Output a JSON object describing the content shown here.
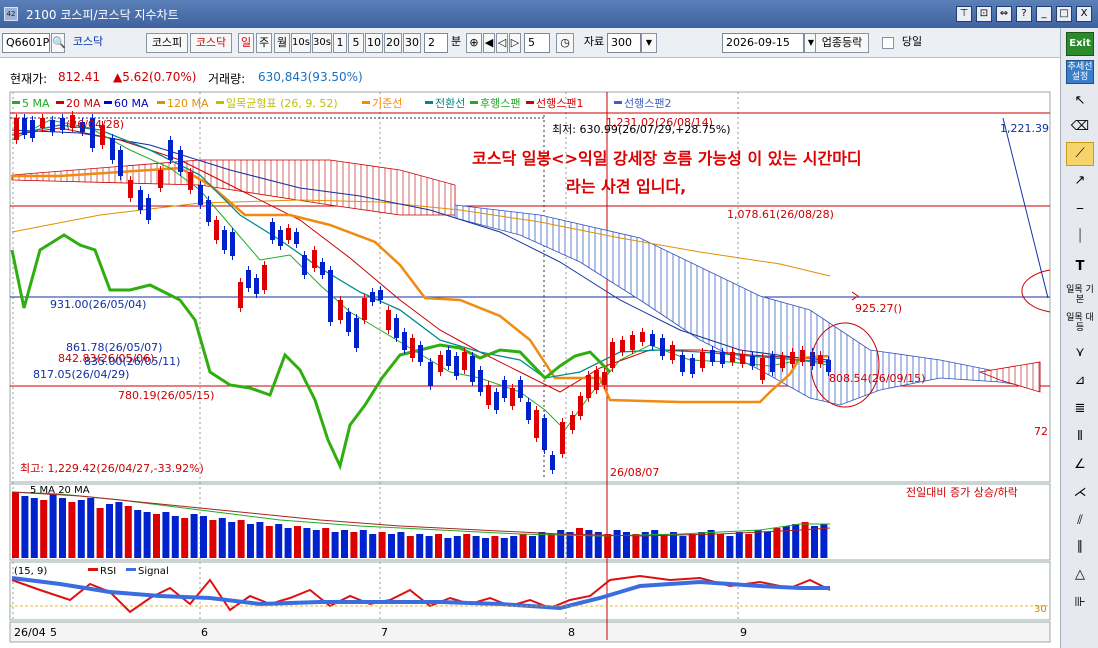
{
  "window": {
    "app_id": "2100",
    "title": "2100 코스피/코스닥 지수차트",
    "controls": [
      "⊤",
      "⊡",
      "⇔",
      "?",
      "_",
      "□",
      "X"
    ]
  },
  "toolbar": {
    "code": "Q6601P",
    "name": "코스닥",
    "market_kospi": "코스피",
    "market_kosdaq": "코스닥",
    "period_daily": "일",
    "period_weekly": "주",
    "period_monthly": "월",
    "period_10s": "10s",
    "period_30s": "30s",
    "min1": "1",
    "min5": "5",
    "min10": "10",
    "min20": "20",
    "min30": "30",
    "n_min_value": "2",
    "n_min_unit": "분",
    "step_value": "5",
    "data_label": "자료",
    "data_count": "300",
    "date": "2026-09-15",
    "sector_button": "업종등락",
    "today_checkbox": "당일"
  },
  "sidebar_tools": {
    "exit": "Exit",
    "trendline_setting": "추세선 설정",
    "ichimoku_base": "일목 기본",
    "ichimoku_equiv": "일목 대등"
  },
  "info": {
    "price_label": "현재가:",
    "price": "812.41",
    "change": "▲5.62(0.70%)",
    "volume_label": "거래량:",
    "volume": "630,843(93.50%)"
  },
  "legend": [
    {
      "label": "5 MA",
      "color": "#22aa22"
    },
    {
      "label": "20 MA",
      "color": "#cc0000"
    },
    {
      "label": "60 MA",
      "color": "#0000cc"
    },
    {
      "label": "120 MA",
      "color": "#e09000"
    },
    {
      "label": "일목균형표 (26, 9, 52)",
      "color": "#c0c000"
    },
    {
      "label": "기준선",
      "color": "#ff8800"
    },
    {
      "label": "전환선",
      "color": "#008888"
    },
    {
      "label": "후행스팬",
      "color": "#22aa22"
    },
    {
      "label": "선행스팬1",
      "color": "#cc0000"
    },
    {
      "label": "선행스팬2",
      "color": "#4060c0"
    }
  ],
  "annotations": {
    "headline_1": "코스닥 일봉<>익일 강세장 흐름 가능성 이 있는 시간마디",
    "headline_2": "라는 사견 입니다,",
    "high_near": "1,231.02(26/08/14)",
    "low_label": "최저: 630.99(26/07/29,+28.75%)",
    "level_1078": "1,078.61(26/08/28)",
    "level_931": "931.00(26/05/04)",
    "level_861": "861.78(26/05/07)",
    "level_842": "842.83(26/05/06)",
    "level_835": "835.00(26/05/11)",
    "level_817": "817.05(26/04/29)",
    "level_780": "780.19(26/05/15)",
    "level_925": "925.27()",
    "level_808": "808.54(26/09/15)",
    "level_1221": "1,221.39",
    "right_72": "72",
    "top_left_label": "(26/04/28)",
    "max_label": "최고: 1,229.42(26/04/27,-33.92%)",
    "date_marker": "26/08/07",
    "volume_title": "전일대비 증가 상승/하락",
    "volume_legend": "5 MA  20 MA",
    "rsi_legend_prefix": "(15, 9)",
    "rsi_legend_rsi": "RSI",
    "rsi_legend_signal": "Signal",
    "rsi_level": "30"
  },
  "x_axis": [
    "26/04",
    "5",
    "6",
    "7",
    "8",
    "9"
  ],
  "colors": {
    "up": "#dd0000",
    "down": "#0022cc",
    "ma5": "#22aa22",
    "ma20": "#cc0000",
    "ma60": "#1030a0",
    "ma120": "#e09000",
    "kijun": "#f08a10",
    "tenkan": "#008c8c",
    "chikou": "#2fae10",
    "span1": "#cc0000",
    "span2": "#3050c0",
    "rsi": "#dd1010",
    "signal": "#3a6ee0"
  }
}
